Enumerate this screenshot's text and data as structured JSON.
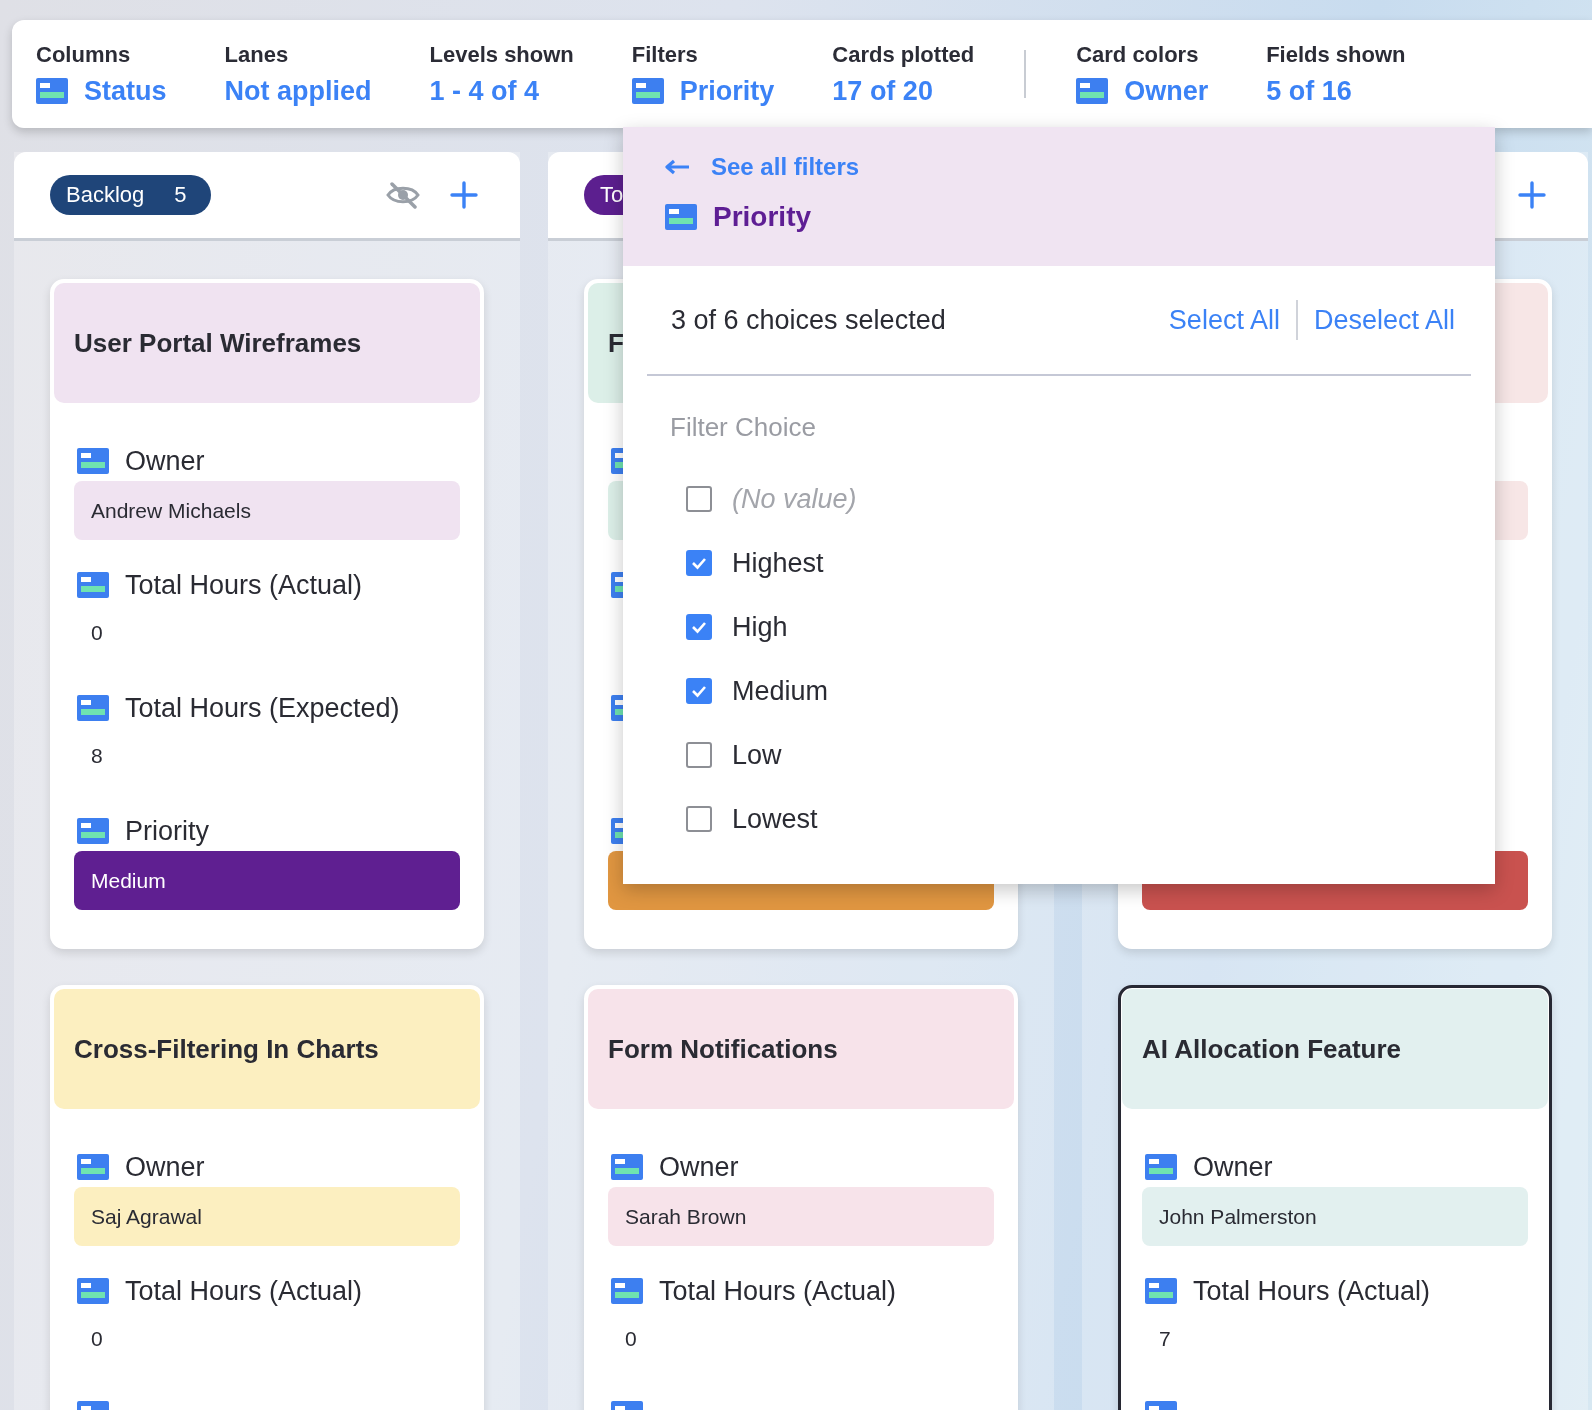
{
  "toolbar": {
    "groups": [
      {
        "items": [
          {
            "label": "Columns",
            "value": "Status",
            "has_icon": true
          },
          {
            "label": "Lanes",
            "value": "Not applied",
            "has_icon": false
          },
          {
            "label": "Levels shown",
            "value": "1 - 4 of 4",
            "has_icon": false
          },
          {
            "label": "Filters",
            "value": "Priority",
            "has_icon": true
          },
          {
            "label": "Cards plotted",
            "value": "17 of 20",
            "has_icon": false
          }
        ]
      },
      {
        "items": [
          {
            "label": "Card colors",
            "value": "Owner",
            "has_icon": true
          },
          {
            "label": "Fields shown",
            "value": "5 of 16",
            "has_icon": false
          }
        ]
      }
    ]
  },
  "columns": [
    {
      "badge": {
        "label": "Backlog",
        "count": "5",
        "color": "#1f4579"
      },
      "cards": [
        {
          "title": "User Portal Wireframes",
          "color": "#f0e3f1",
          "selected": false,
          "fields": [
            {
              "kind": "owner",
              "label": "Owner",
              "value": "Andrew Michaels"
            },
            {
              "kind": "number",
              "label": "Total Hours (Actual)",
              "value": "0"
            },
            {
              "kind": "number",
              "label": "Total Hours (Expected)",
              "value": "8"
            },
            {
              "kind": "priority",
              "label": "Priority",
              "value": "Medium",
              "color": "#5f1f91"
            }
          ]
        },
        {
          "title": "Cross-Filtering In Charts",
          "color": "#fcefc0",
          "selected": false,
          "fields": [
            {
              "kind": "owner",
              "label": "Owner",
              "value": "Saj Agrawal"
            },
            {
              "kind": "number",
              "label": "Total Hours (Actual)",
              "value": "0"
            },
            {
              "kind": "number"
            }
          ]
        }
      ]
    },
    {
      "badge": {
        "label": "To",
        "color": "#5c1f8f"
      },
      "cards": [
        {
          "title": "F",
          "color": "#dcefe8",
          "selected": false,
          "fields": [
            {
              "kind": "owner"
            },
            {
              "kind": "number"
            },
            {
              "kind": "number"
            },
            {
              "kind": "priority",
              "color": "#e09641"
            }
          ]
        },
        {
          "title": "Form Notifications",
          "color": "#f7e3ea",
          "selected": false,
          "fields": [
            {
              "kind": "owner",
              "label": "Owner",
              "value": "Sarah Brown"
            },
            {
              "kind": "number",
              "label": "Total Hours (Actual)",
              "value": "0"
            },
            {
              "kind": "number"
            }
          ]
        }
      ]
    },
    {
      "cards": [
        {
          "color": "#f7e6e6",
          "selected": false,
          "fields": [
            {
              "kind": "owner"
            },
            {
              "kind": "number"
            },
            {
              "kind": "number"
            },
            {
              "kind": "priority",
              "color": "#c9524f"
            }
          ]
        },
        {
          "title": "AI Allocation Feature",
          "color": "#e2f0ef",
          "selected": true,
          "fields": [
            {
              "kind": "owner",
              "label": "Owner",
              "value": "John Palmerston"
            },
            {
              "kind": "number",
              "label": "Total Hours (Actual)",
              "value": "7"
            },
            {
              "kind": "number"
            }
          ]
        }
      ]
    }
  ],
  "filter_popup": {
    "back_link": "See all filters",
    "title": "Priority",
    "summary": "3 of 6 choices selected",
    "actions": [
      "Select All",
      "Deselect All"
    ],
    "section": "Filter Choice",
    "choices": [
      {
        "label": "(No value)",
        "kind": "empty",
        "checked": false
      },
      {
        "label": "Highest",
        "kind": "value",
        "checked": true
      },
      {
        "label": "High",
        "kind": "value",
        "checked": true
      },
      {
        "label": "Medium",
        "kind": "value",
        "checked": true
      },
      {
        "label": "Low",
        "kind": "value",
        "checked": false
      },
      {
        "label": "Lowest",
        "kind": "value",
        "checked": false
      }
    ]
  }
}
